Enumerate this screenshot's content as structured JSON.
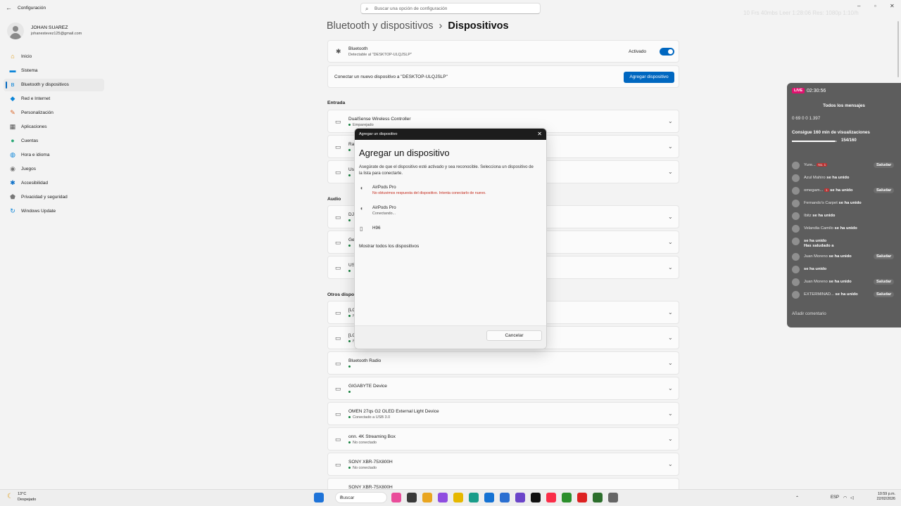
{
  "window": {
    "title": "Configuración",
    "search_placeholder": "Buscar una opción de configuración",
    "faint_overlay": "10 Frs   40mbs   Leer   1:28:06   Res: 1080p 1:10/h"
  },
  "user": {
    "name": "JOHAN SUAREZ",
    "email": "johanestevez125@gmail.com"
  },
  "nav": [
    {
      "label": "Inicio",
      "icon": "home-icon",
      "glyph": "⌂",
      "color": "#e0a020"
    },
    {
      "label": "Sistema",
      "icon": "system-icon",
      "glyph": "▬",
      "color": "#0a84d8"
    },
    {
      "label": "Bluetooth y dispositivos",
      "icon": "bluetooth-icon",
      "glyph": "ʙ",
      "color": "#0a84d8"
    },
    {
      "label": "Red e Internet",
      "icon": "wifi-icon",
      "glyph": "◆",
      "color": "#0a84d8"
    },
    {
      "label": "Personalización",
      "icon": "brush-icon",
      "glyph": "✎",
      "color": "#d9662a"
    },
    {
      "label": "Aplicaciones",
      "icon": "apps-icon",
      "glyph": "▦",
      "color": "#555555"
    },
    {
      "label": "Cuentas",
      "icon": "accounts-icon",
      "glyph": "●",
      "color": "#2aa876"
    },
    {
      "label": "Hora e idioma",
      "icon": "globe-clock-icon",
      "glyph": "◍",
      "color": "#0a84d8"
    },
    {
      "label": "Juegos",
      "icon": "gamepad-icon",
      "glyph": "◉",
      "color": "#777777"
    },
    {
      "label": "Accesibilidad",
      "icon": "accessibility-icon",
      "glyph": "✱",
      "color": "#0a6fc8"
    },
    {
      "label": "Privacidad y seguridad",
      "icon": "shield-icon",
      "glyph": "⬟",
      "color": "#777777"
    },
    {
      "label": "Windows Update",
      "icon": "update-icon",
      "glyph": "↻",
      "color": "#0a84d8"
    }
  ],
  "breadcrumb": {
    "parent": "Bluetooth y dispositivos",
    "sep": "›",
    "current": "Dispositivos"
  },
  "bluetooth": {
    "title": "Bluetooth",
    "sub": "Detectable al \"DESKTOP-ULQJSLP\"",
    "state": "Activado"
  },
  "connect": {
    "text": "Conectar un nuevo dispositivo a \"DESKTOP-ULQJSLP\"",
    "button": "Agregar dispositivo"
  },
  "sections": {
    "entrada": "Entrada",
    "audio": "Audio",
    "otros": "Otros dispositivos"
  },
  "entrada_rows": [
    {
      "name": "DualSense Wireless Controller",
      "sub": "Emparejado"
    },
    {
      "name": "Ra",
      "sub": ""
    },
    {
      "name": "Us",
      "sub": ""
    }
  ],
  "audio_rows": [
    {
      "name": "DJ",
      "sub": ""
    },
    {
      "name": "Ge",
      "sub": ""
    },
    {
      "name": "US",
      "sub": ""
    }
  ],
  "otros_rows": [
    {
      "name": "[LG",
      "sub": "No"
    },
    {
      "name": "[LG",
      "sub": "No"
    },
    {
      "name": "Bluetooth Radio",
      "sub": ""
    },
    {
      "name": "GIGABYTE Device",
      "sub": ""
    },
    {
      "name": "OMEN 27qs G2 OLED External Light Device",
      "sub": "Conectado a USB 3.0"
    },
    {
      "name": "onn. 4K Streaming Box",
      "sub": "No conectado"
    },
    {
      "name": "SONY XBR-75X800H",
      "sub": "No conectado"
    },
    {
      "name": "SONY XBR-75X800H",
      "sub": ""
    }
  ],
  "modal": {
    "header": "Agregar un dispositivo",
    "title": "Agregar un dispositivo",
    "desc": "Asegúrate de que el dispositivo esté activado y sea reconocible. Selecciona un dispositivo de la lista para conectarte.",
    "devices": [
      {
        "name": "AirPods Pro",
        "status": "No obtuvimos respuesta del dispositivo. Intenta conectarlo de nuevo.",
        "error": true
      },
      {
        "name": "AirPods Pro",
        "status": "Conectando...",
        "error": false
      },
      {
        "name": "H96",
        "status": "",
        "error": false
      }
    ],
    "show_all": "Mostrar todos los dispositivos",
    "cancel": "Cancelar"
  },
  "live": {
    "badge": "LIVE",
    "time": "02:30:56",
    "header": "Todos los mensajes",
    "stats": "0   69   0   0   1.397",
    "goal": "Consigue 160 min de visualizaciones",
    "goal_progress": 0.9625,
    "goal_count": "154/160",
    "chat": [
      {
        "name": "Yure...",
        "text": "",
        "badge": "Saludar",
        "extra": "No. 1"
      },
      {
        "name": "Azul Mahiro",
        "text": "se ha unido",
        "badge": ""
      },
      {
        "name": "omegam...",
        "text": "se ha unido",
        "badge": "Saludar",
        "extra": "1"
      },
      {
        "name": "Fernando's Carpet",
        "text": "se ha unido",
        "badge": ""
      },
      {
        "name": "Ibitz",
        "text": "se ha unido",
        "badge": ""
      },
      {
        "name": "Velandia Camilo",
        "text": "se ha unido",
        "badge": ""
      },
      {
        "name": "",
        "text": "se ha unido",
        "badge": "",
        "line2": "Has saludado a"
      },
      {
        "name": "Juan Moreno",
        "text": "se ha unido",
        "badge": "Saludar"
      },
      {
        "name": "",
        "text": "se ha unido",
        "badge": ""
      },
      {
        "name": "Juan Moreno",
        "text": "se ha unido",
        "badge": "Saludar"
      },
      {
        "name": "EXTERMINAD...",
        "text": "se ha unido",
        "badge": "Saludar"
      }
    ],
    "input_placeholder": "Añadir comentario"
  },
  "taskbar": {
    "weather_temp": "13°C",
    "weather_desc": "Despejado",
    "search": "Buscar",
    "lang": "ESP",
    "time": "10:59 p.m.",
    "date": "22/02/2026"
  }
}
